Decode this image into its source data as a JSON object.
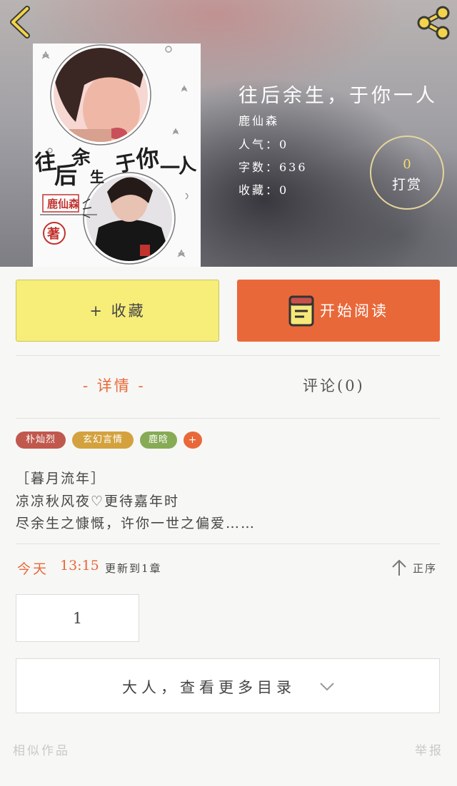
{
  "header": {
    "back_icon": "back-chevron-icon",
    "share_icon": "share-icon"
  },
  "cover": {
    "art_text": "往后余生 于你一人",
    "author_badge": "鹿仙森",
    "seal": "著"
  },
  "book": {
    "title": "往后余生，于你一人",
    "author": "鹿仙森",
    "popularity": "人气：0",
    "word_count": "字数：636",
    "favorites": "收藏：0"
  },
  "tip": {
    "count": "0",
    "label": "打赏"
  },
  "actions": {
    "collect_label": "+ 收藏",
    "read_label": "开始阅读",
    "read_icon": "book-icon"
  },
  "tabs": {
    "detail": "- 详情 -",
    "comment": "评论(0)"
  },
  "tags": [
    {
      "label": "朴灿烈",
      "color": "#c0584d"
    },
    {
      "label": "玄幻言情",
      "color": "#d3a23e"
    },
    {
      "label": "鹿晗",
      "color": "#87ab55"
    },
    {
      "label": "+",
      "color": "#e9683a"
    }
  ],
  "description": [
    "［暮月流年］",
    "凉凉秋风夜♡更待嘉年时",
    "尽余生之慷慨，许你一世之偏爱……"
  ],
  "update": {
    "day": "今天",
    "time": "13:15",
    "text": "更新到1章",
    "sort_label": "正序",
    "sort_icon": "arrow-up-icon"
  },
  "chapters": [
    "1"
  ],
  "more_catalog": "大人，查看更多目录",
  "footer": {
    "similar": "相似作品",
    "report": "举报"
  },
  "colors": {
    "accent": "#e9683a",
    "collect_bg": "#f7ee7a",
    "gold": "#f2dc74"
  }
}
